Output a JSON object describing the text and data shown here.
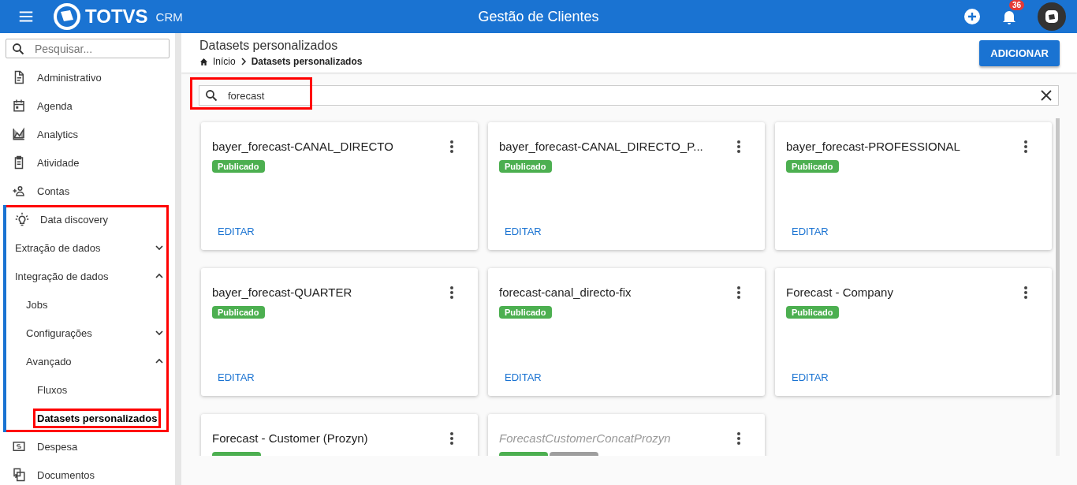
{
  "topbar": {
    "brand": "TOTVS",
    "product": "CRM",
    "title": "Gestão de Clientes",
    "notifications": "36"
  },
  "sidebar": {
    "search": {
      "placeholder": "Pesquisar..."
    },
    "items": [
      {
        "label": "Administrativo",
        "selected": false
      },
      {
        "label": "Agenda",
        "selected": false
      },
      {
        "label": "Analytics",
        "selected": false
      },
      {
        "label": "Atividade",
        "selected": false
      },
      {
        "label": "Contas",
        "selected": false
      },
      {
        "label": "Data discovery",
        "selected": false,
        "active": true,
        "highlighted": true,
        "children": [
          {
            "label": "Extração de dados",
            "selected": false,
            "expanded": false
          },
          {
            "label": "Integração de dados",
            "selected": false,
            "expanded": true,
            "children": [
              {
                "label": "Jobs",
                "selected": false
              },
              {
                "label": "Configurações",
                "selected": false,
                "expanded": false
              },
              {
                "label": "Avançado",
                "selected": false,
                "expanded": true,
                "children": [
                  {
                    "label": "Fluxos",
                    "selected": false
                  },
                  {
                    "label": "Datasets personalizados",
                    "selected": true,
                    "highlighted": true
                  }
                ]
              }
            ]
          }
        ]
      },
      {
        "label": "Despesa",
        "selected": false
      },
      {
        "label": "Documentos",
        "selected": false
      }
    ]
  },
  "page": {
    "title": "Datasets personalizados",
    "breadcrumb": [
      "Início",
      "Datasets personalizados"
    ],
    "add_button": "ADICIONAR"
  },
  "search": {
    "value": "forecast",
    "highlighted": true
  },
  "cards": [
    {
      "title": "bayer_forecast-CANAL_DIRECTO",
      "inactive": false,
      "badges": [
        {
          "label": "Publicado",
          "color": "#4caf50"
        }
      ],
      "action": "EDITAR"
    },
    {
      "title": "bayer_forecast-CANAL_DIRECTO_P...",
      "inactive": false,
      "badges": [
        {
          "label": "Publicado",
          "color": "#4caf50"
        }
      ],
      "action": "EDITAR"
    },
    {
      "title": "bayer_forecast-PROFESSIONAL",
      "inactive": false,
      "badges": [
        {
          "label": "Publicado",
          "color": "#4caf50"
        }
      ],
      "action": "EDITAR"
    },
    {
      "title": "bayer_forecast-QUARTER",
      "inactive": false,
      "badges": [
        {
          "label": "Publicado",
          "color": "#4caf50"
        }
      ],
      "action": "EDITAR"
    },
    {
      "title": "forecast-canal_directo-fix",
      "inactive": false,
      "badges": [
        {
          "label": "Publicado",
          "color": "#4caf50"
        }
      ],
      "action": "EDITAR"
    },
    {
      "title": "Forecast - Company",
      "inactive": false,
      "badges": [
        {
          "label": "Publicado",
          "color": "#4caf50"
        }
      ],
      "action": "EDITAR"
    },
    {
      "title": "Forecast - Customer (Prozyn)",
      "inactive": false,
      "badges": [
        {
          "color": "#4caf50"
        }
      ]
    },
    {
      "title": "ForecastCustomerConcatProzyn",
      "inactive": true,
      "badges": [
        {
          "color": "#4caf50"
        },
        {
          "color": "#9e9e9e"
        }
      ]
    }
  ]
}
